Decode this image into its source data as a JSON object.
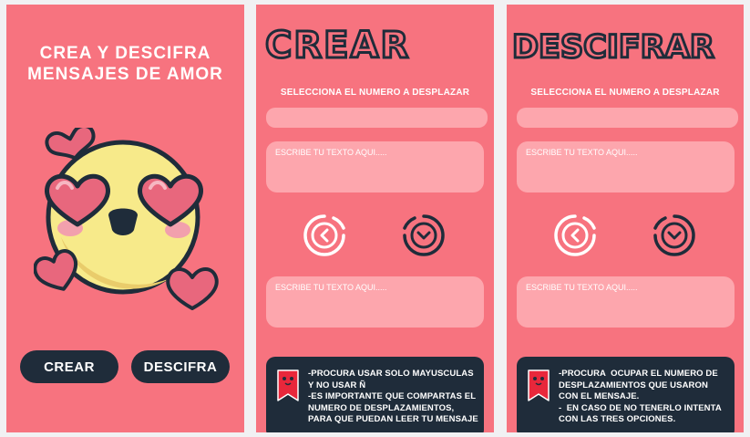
{
  "home": {
    "title_line1": "CREA Y DESCIFRA",
    "title_line2": "MENSAJES DE AMOR",
    "emoji_icon": "heart-eyes-emoji-icon",
    "crear_button": "CREAR",
    "descifra_button": "DESCIFRA"
  },
  "crear": {
    "title": "CREAR",
    "shift_label": "SELECCIONA EL NUMERO A DESPLAZAR",
    "input_placeholder": "ESCRIBE TU TEXTO AQUI.....",
    "output_placeholder": "ESCRIBE TU TEXTO AQUI.....",
    "back_icon": "chevron-left-circle-icon",
    "go_icon": "chevron-down-circle-icon",
    "tips": [
      "-PROCURA USAR SOLO MAYUSCULAS",
      "Y NO USAR Ñ",
      "-ES IMPORTANTE QUE COMPARTAS EL",
      "NUMERO DE DESPLAZAMIENTOS,",
      "PARA QUE PUEDAN LEER TU MENSAJE"
    ]
  },
  "descifrar": {
    "title": "DESCIFRAR",
    "shift_label": "SELECCIONA EL NUMERO A DESPLAZAR",
    "input_placeholder": "ESCRIBE TU TEXTO AQUI.....",
    "output_placeholder": "ESCRIBE TU TEXTO AQUI.....",
    "back_icon": "chevron-left-circle-icon",
    "go_icon": "chevron-down-circle-icon",
    "tips": [
      "-PROCURA  OCUPAR EL NUMERO DE",
      "DESPLAZAMIENTOS QUE USARON",
      "CON EL MENSAJE.",
      "-  EN CASO DE NO TENERLO INTENTA",
      "CON LAS TRES OPCIONES."
    ]
  },
  "colors": {
    "background": "#f7737f",
    "field": "#fda6ad",
    "dark": "#1f2c3a",
    "emoji_yellow": "#f7ea8a",
    "heart_pink": "#e8677d"
  }
}
